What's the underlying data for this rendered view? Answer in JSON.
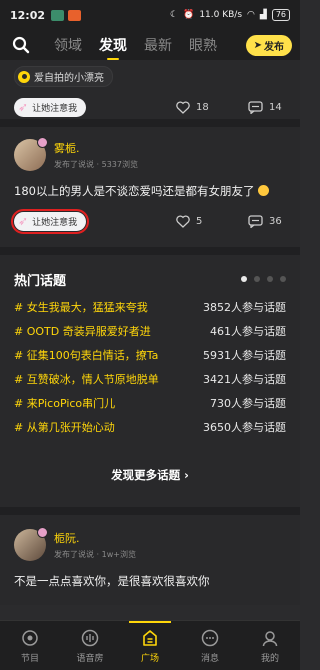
{
  "status_bar": {
    "time": "12:02",
    "network_speed": "11.0 KB/s",
    "battery": "76"
  },
  "nav": {
    "tabs": [
      "领域",
      "发现",
      "最新",
      "眼熟"
    ],
    "active_tab": "发现",
    "publish_label": "发布"
  },
  "post1": {
    "tag": "爱自拍的小漂亮",
    "notice_label": "让她注意我",
    "likes": "18",
    "comments": "14"
  },
  "post2": {
    "username": "雾栀.",
    "meta": "发布了说说 · 5337浏览",
    "text": "180以上的男人是不谈恋爱吗还是都有女朋友了",
    "notice_label": "让她注意我",
    "likes": "5",
    "comments": "36"
  },
  "hot_topics": {
    "title": "热门话题",
    "items": [
      {
        "name": "# 女生我最大，猛猛来夸我",
        "count": "3852人参与话题"
      },
      {
        "name": "# OOTD 奇装异服爱好者进",
        "count": "461人参与话题"
      },
      {
        "name": "# 征集100句表白情话，撩Ta",
        "count": "5931人参与话题"
      },
      {
        "name": "# 互赞破冰，情人节原地脱单",
        "count": "3421人参与话题"
      },
      {
        "name": "# 来PicoPico串门儿",
        "count": "730人参与话题"
      },
      {
        "name": "# 从第几张开始心动",
        "count": "3650人参与话题"
      }
    ],
    "discover_more": "发现更多话题 ›"
  },
  "post3": {
    "username": "栀阮.",
    "meta": "发布了说说 · 1w+浏览",
    "text": "不是一点点喜欢你，是很喜欢很喜欢你"
  },
  "bottom_nav": [
    "节目",
    "语音房",
    "广场",
    "消息",
    "我的"
  ],
  "colors": {
    "accent": "#ffd60a",
    "background": "#29292b",
    "highlight": "#e02020"
  }
}
